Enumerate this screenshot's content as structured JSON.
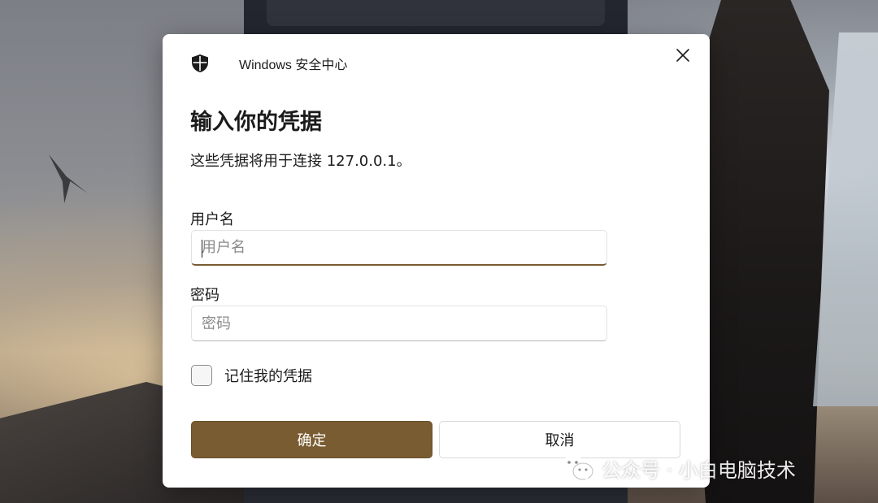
{
  "dialog": {
    "app_title": "Windows 安全中心",
    "heading": "输入你的凭据",
    "description": "这些凭据将用于连接 127.0.0.1。",
    "username": {
      "label": "用户名",
      "placeholder": "用户名",
      "value": ""
    },
    "password": {
      "label": "密码",
      "placeholder": "密码",
      "value": ""
    },
    "remember": {
      "label": "记住我的凭据",
      "checked": false
    },
    "ok_label": "确定",
    "cancel_label": "取消"
  },
  "watermark": {
    "text": "公众号 · 小白电脑技术"
  },
  "icons": {
    "app": "shield-icon",
    "close": "close-icon",
    "watermark": "wechat-icon"
  },
  "colors": {
    "accent": "#7a5c32",
    "dialog_background": "#ffffff",
    "text": "#1b1b1b"
  }
}
